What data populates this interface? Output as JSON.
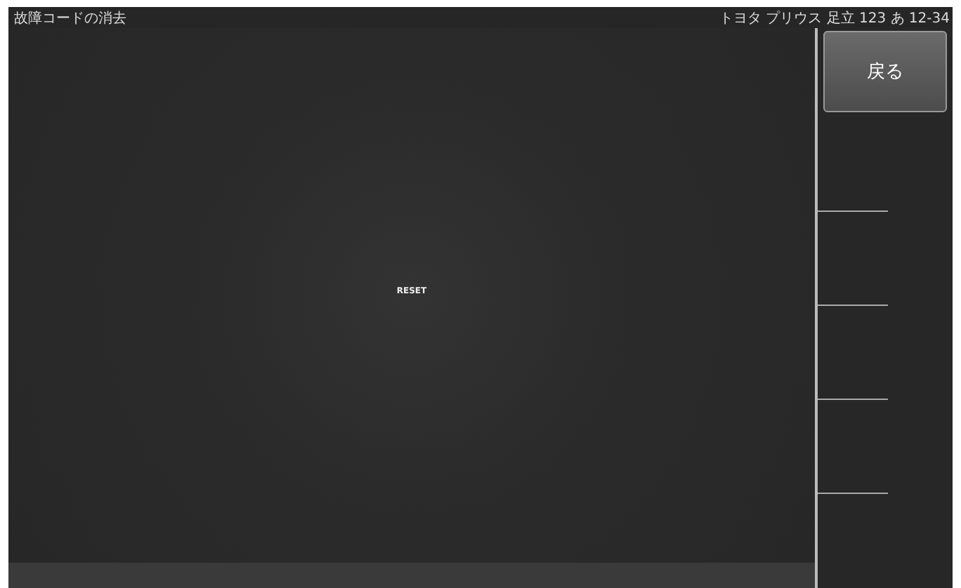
{
  "header": {
    "title": "故障コードの消去",
    "vehicle": "トヨタ プリウス 足立 123 あ 12-34"
  },
  "main": {
    "label": "RESET"
  },
  "side": {
    "back_button": "戻る"
  }
}
